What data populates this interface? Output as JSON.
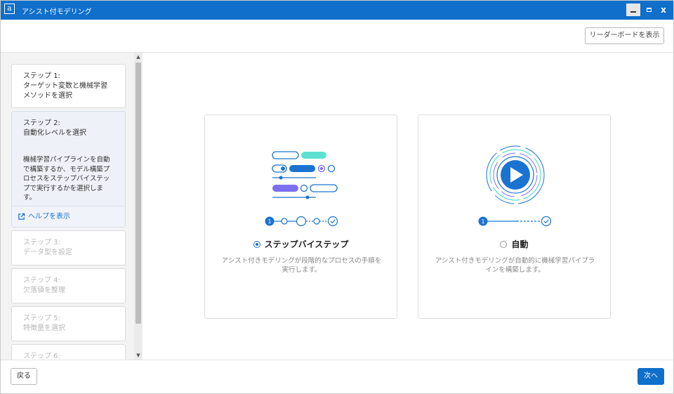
{
  "window": {
    "title": "アシスト付モデリング",
    "app_icon": "a",
    "close_glyph": "x"
  },
  "toolbar": {
    "leaderboard_label": "リーダーボードを表示"
  },
  "sidebar": {
    "steps": [
      {
        "label": "ステップ 1:",
        "title": "ターゲット変数と機械学習メソッドを選択",
        "state": "completed"
      },
      {
        "label": "ステップ 2:",
        "title": "自動化レベルを選択",
        "state": "active",
        "description": "機械学習パイプラインを自動で構築するか、モデル構築プロセスをステップバイステップで実行するかを選択します。"
      },
      {
        "label": "ステップ 3:",
        "title": "データ型を設定",
        "state": "disabled"
      },
      {
        "label": "ステップ 4:",
        "title": "欠落値を整理",
        "state": "disabled"
      },
      {
        "label": "ステップ 5:",
        "title": "特徴量を選択",
        "state": "disabled"
      },
      {
        "label": "ステップ 6:",
        "title": "",
        "state": "disabled"
      }
    ],
    "help_label": "ヘルプを表示",
    "scroll_up": "▲",
    "scroll_down": "▼"
  },
  "options": {
    "step_by_step": {
      "label": "ステップバイステップ",
      "description": "アシスト付きモデリングが段階的なプロセスの手順を実行します。",
      "selected": true,
      "progress_marker": "1"
    },
    "automatic": {
      "label": "自動",
      "description": "アシスト付きモデリングが自動的に機械学習パイプラインを構築します。",
      "selected": false,
      "progress_marker": "1"
    }
  },
  "footer": {
    "back_label": "戻る",
    "next_label": "次へ"
  },
  "colors": {
    "primary": "#0f6fcb",
    "accent_blue": "#1a73d1",
    "teal": "#5fe0d3",
    "purple": "#7b6ff0",
    "sidebar_bg": "#f3f3f3"
  }
}
